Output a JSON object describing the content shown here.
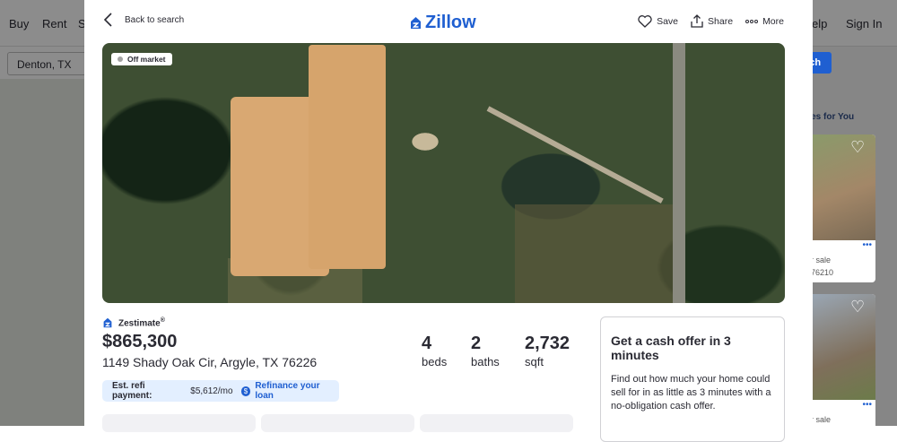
{
  "background": {
    "nav": [
      "Buy",
      "Rent",
      "S",
      "elp",
      "Sign In"
    ],
    "search_value": "Denton, TX",
    "search_btn": "rch",
    "sidebar_title": "nes for You",
    "card1": {
      "line1": "r sale",
      "line2": "76210"
    },
    "card2": {
      "line1": "r sale"
    }
  },
  "topbar": {
    "back_label": "Back to search",
    "logo": "Zillow",
    "save": "Save",
    "share": "Share",
    "more": "More"
  },
  "photo": {
    "badge": "Off market"
  },
  "zestimate": {
    "label": "Zestimate",
    "sup": "®",
    "price": "$865,300",
    "address": "1149 Shady Oak Cir, Argyle, TX 76226"
  },
  "stats": [
    {
      "value": "4",
      "label": "beds"
    },
    {
      "value": "2",
      "label": "baths"
    },
    {
      "value": "2,732",
      "label": "sqft"
    }
  ],
  "refi": {
    "label": "Est. refi payment:",
    "value": "$5,612/mo",
    "link": "Refinance your loan"
  },
  "offer": {
    "title": "Get a cash offer in 3 minutes",
    "body": "Find out how much your home could sell for in as little as 3 minutes with a no-obligation cash offer."
  },
  "colors": {
    "brand": "#1f5fd1"
  }
}
